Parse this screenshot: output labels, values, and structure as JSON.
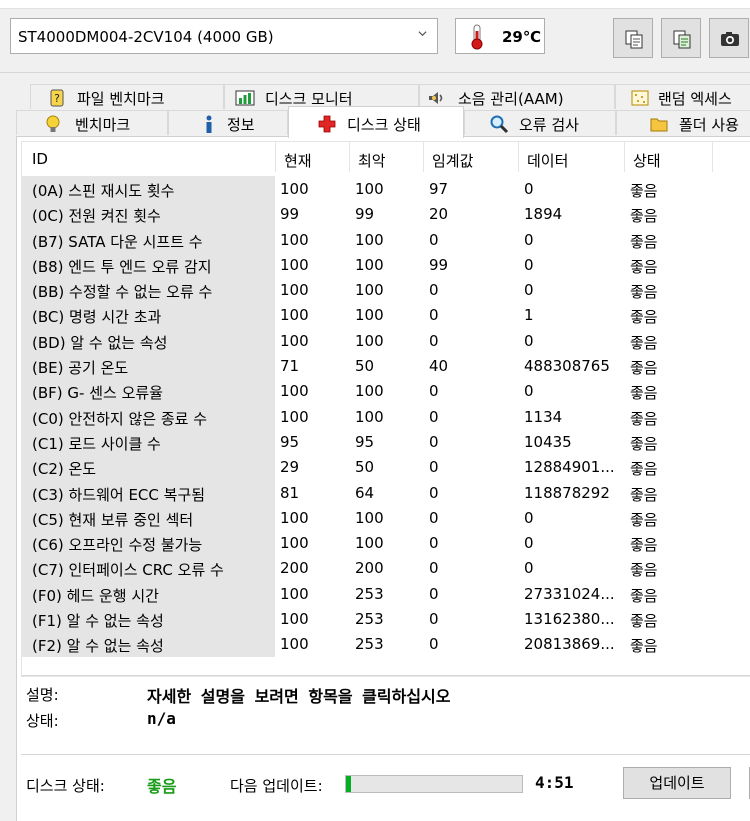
{
  "toolbar": {
    "drive": "ST4000DM004-2CV104 (4000 GB)",
    "temperature": "29℃",
    "icons": [
      "copy-icon",
      "copy-all-icon",
      "screenshot-icon"
    ]
  },
  "tabs": {
    "row1": [
      {
        "label": "파일 벤치마크",
        "icon": "file-benchmark-icon"
      },
      {
        "label": "디스크 모니터",
        "icon": "disk-monitor-icon"
      },
      {
        "label": "소음 관리(AAM)",
        "icon": "speaker-icon"
      },
      {
        "label": "랜덤 엑세스",
        "icon": "random-access-icon"
      }
    ],
    "row2": [
      {
        "label": "벤치마크",
        "icon": "benchmark-icon"
      },
      {
        "label": "정보",
        "icon": "info-icon"
      },
      {
        "label": "디스크 상태",
        "icon": "health-cross-icon"
      },
      {
        "label": "오류 검사",
        "icon": "magnifier-icon"
      },
      {
        "label": "폴더 사용",
        "icon": "folder-icon"
      }
    ],
    "active": "디스크 상태"
  },
  "smart": {
    "columns": [
      "ID",
      "현재",
      "최악",
      "임계값",
      "데이터",
      "상태"
    ],
    "rows": [
      [
        "(0A) 스핀 재시도 횟수",
        "100",
        "100",
        "97",
        "0",
        "좋음"
      ],
      [
        "(0C) 전원 켜진 횟수",
        "99",
        "99",
        "20",
        "1894",
        "좋음"
      ],
      [
        "(B7) SATA 다운 시프트 수",
        "100",
        "100",
        "0",
        "0",
        "좋음"
      ],
      [
        "(B8) 엔드 투 엔드 오류 감지",
        "100",
        "100",
        "99",
        "0",
        "좋음"
      ],
      [
        "(BB) 수정할 수 없는 오류 수",
        "100",
        "100",
        "0",
        "0",
        "좋음"
      ],
      [
        "(BC) 명령 시간 초과",
        "100",
        "100",
        "0",
        "1",
        "좋음"
      ],
      [
        "(BD) 알 수 없는 속성",
        "100",
        "100",
        "0",
        "0",
        "좋음"
      ],
      [
        "(BE) 공기 온도",
        "71",
        "50",
        "40",
        "488308765",
        "좋음"
      ],
      [
        "(BF) G- 센스 오류율",
        "100",
        "100",
        "0",
        "0",
        "좋음"
      ],
      [
        "(C0) 안전하지 않은 종료 수",
        "100",
        "100",
        "0",
        "1134",
        "좋음"
      ],
      [
        "(C1) 로드 사이클 수",
        "95",
        "95",
        "0",
        "10435",
        "좋음"
      ],
      [
        "(C2) 온도",
        "29",
        "50",
        "0",
        "12884901...",
        "좋음"
      ],
      [
        "(C3) 하드웨어 ECC 복구됨",
        "81",
        "64",
        "0",
        "118878292",
        "좋음"
      ],
      [
        "(C5) 현재 보류 중인 섹터",
        "100",
        "100",
        "0",
        "0",
        "좋음"
      ],
      [
        "(C6) 오프라인 수정 불가능",
        "100",
        "100",
        "0",
        "0",
        "좋음"
      ],
      [
        "(C7) 인터페이스 CRC 오류 수",
        "200",
        "200",
        "0",
        "0",
        "좋음"
      ],
      [
        "(F0) 헤드 운행 시간",
        "100",
        "253",
        "0",
        "27331024...",
        "좋음"
      ],
      [
        "(F1) 알 수 없는 속성",
        "100",
        "253",
        "0",
        "13162380...",
        "좋음"
      ],
      [
        "(F2) 알 수 없는 속성",
        "100",
        "253",
        "0",
        "20813869...",
        "좋음"
      ]
    ]
  },
  "details": {
    "desc_label": "설명:",
    "desc_value": "자세한 설명을 보려면 항목을 클릭하십시오",
    "state_label": "상태:",
    "state_value": "n/a"
  },
  "footer": {
    "disk_state_label": "디스크 상태:",
    "disk_state_value": "좋음",
    "disk_state_color": "#1a9b1a",
    "next_update_label": "다음 업데이트:",
    "progress_fraction": 0.03,
    "countdown": "4:51",
    "update_button": "업데이트"
  }
}
